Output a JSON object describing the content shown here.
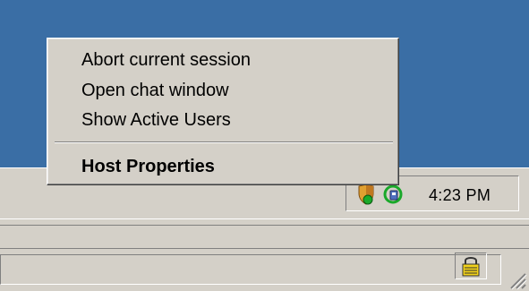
{
  "context_menu": {
    "items": [
      {
        "label": "Abort current session",
        "bold": false
      },
      {
        "label": "Open chat window",
        "bold": false
      },
      {
        "label": "Show Active Users",
        "bold": false
      },
      {
        "label": "Host Properties",
        "bold": true
      }
    ]
  },
  "tray": {
    "clock": "4:23 PM",
    "icons": [
      "shield-icon",
      "network-icon",
      "lock-icon"
    ]
  },
  "colors": {
    "desktop": "#3a6ea5",
    "face": "#d4d0c8"
  }
}
